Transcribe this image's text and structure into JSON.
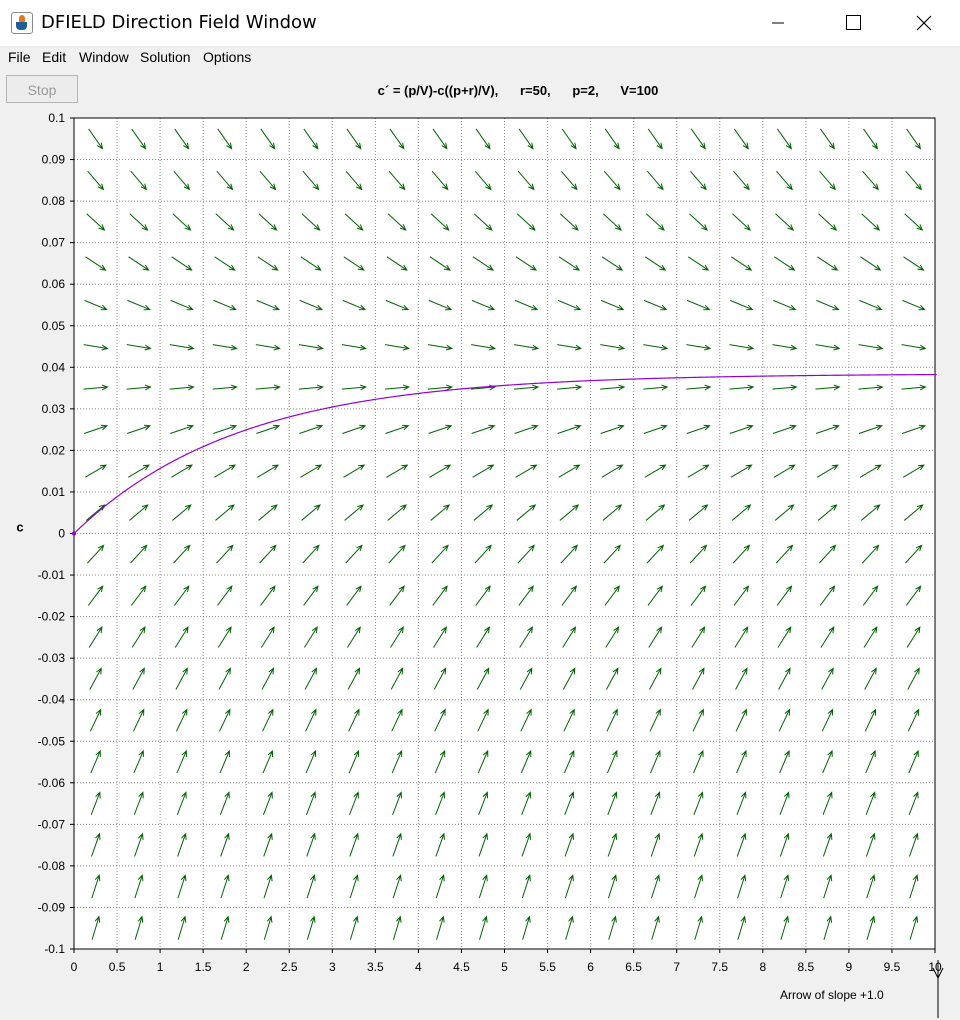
{
  "window": {
    "title": "DFIELD Direction Field Window"
  },
  "menu": [
    "File",
    "Edit",
    "Window",
    "Solution",
    "Options"
  ],
  "toolbar": {
    "stop_label": "Stop"
  },
  "equation": "c´ = (p/V)-c((p+r)/V),      r=50,      p=2,      V=100",
  "footer": {
    "slope_label": "Arrow of slope +1.0"
  },
  "colors": {
    "arrow": "#006400",
    "solution": "#9400d3",
    "grid": "#888888"
  },
  "chart_data": {
    "type": "direction-field",
    "ode": {
      "p": 2,
      "V": 100,
      "r": 50
    },
    "ylabel": "c",
    "xlim": [
      0,
      10
    ],
    "ylim": [
      -0.1,
      0.1
    ],
    "x_ticks": [
      "0",
      "0.5",
      "1",
      "1.5",
      "2",
      "2.5",
      "3",
      "3.5",
      "4",
      "4.5",
      "5",
      "5.5",
      "6",
      "6.5",
      "7",
      "7.5",
      "8",
      "8.5",
      "9",
      "9.5",
      "10"
    ],
    "y_ticks": [
      "0.1",
      "0.09",
      "0.08",
      "0.07",
      "0.06",
      "0.05",
      "0.04",
      "0.03",
      "0.02",
      "0.01",
      "0",
      "-0.01",
      "-0.02",
      "-0.03",
      "-0.04",
      "-0.05",
      "-0.06",
      "-0.07",
      "-0.08",
      "-0.09",
      "-0.1"
    ],
    "grid": true,
    "field_columns": 20,
    "field_rows": 20,
    "solution": {
      "x0": 0,
      "y0": 0,
      "t_end": 10
    }
  }
}
